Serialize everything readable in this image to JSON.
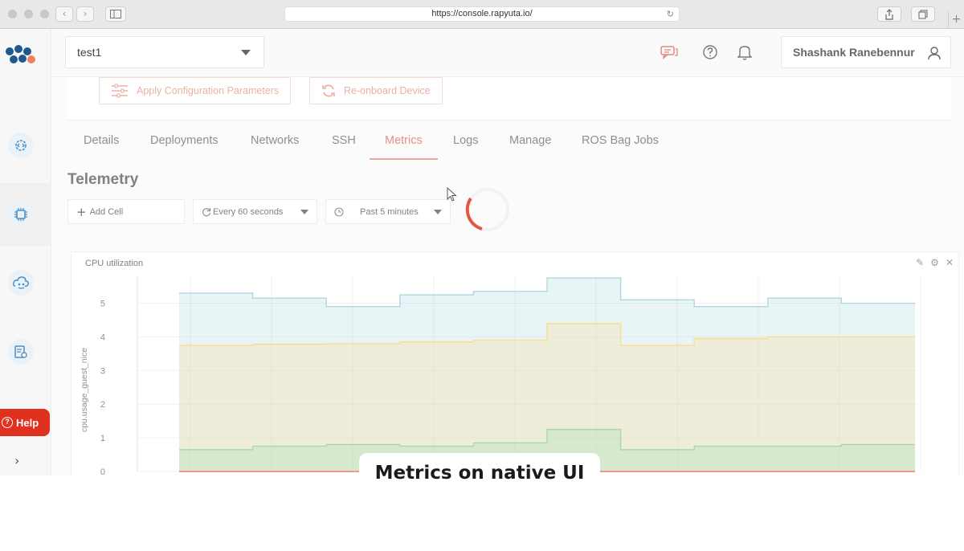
{
  "browser": {
    "url": "https://console.rapyuta.io/",
    "back_icon": "chevron-left-icon",
    "forward_icon": "chevron-right-icon",
    "sidebar_icon": "sidebar-toggle-icon",
    "share_icon": "share-icon",
    "tabs_icon": "tabs-overview-icon",
    "new_tab_icon": "plus-icon"
  },
  "header": {
    "project": "test1",
    "user_name": "Shashank Ranebennur"
  },
  "sidebar": {
    "help_label": "Help",
    "items": [
      {
        "icon": "gear-code-icon"
      },
      {
        "icon": "chip-icon"
      },
      {
        "icon": "cloud-robot-icon"
      },
      {
        "icon": "document-settings-icon"
      }
    ]
  },
  "actions": {
    "apply_config": "Apply Configuration Parameters",
    "reonboard": "Re-onboard Device"
  },
  "tabs": [
    {
      "label": "Details"
    },
    {
      "label": "Deployments"
    },
    {
      "label": "Networks"
    },
    {
      "label": "SSH"
    },
    {
      "label": "Metrics",
      "active": true
    },
    {
      "label": "Logs"
    },
    {
      "label": "Manage"
    },
    {
      "label": "ROS Bag Jobs"
    }
  ],
  "telemetry": {
    "title": "Telemetry",
    "add_cell": "Add Cell",
    "refresh": "Every 60 seconds",
    "range": "Past 5 minutes"
  },
  "colors": {
    "accent": "#e0301e",
    "series_blue": "#9ed0d6",
    "series_yellow": "#f7d675",
    "series_green": "#8fd19e",
    "series_red": "#e06060"
  },
  "chart_data": {
    "type": "area",
    "title": "CPU utilization",
    "ylabel": "cpu.usage_guest_nice",
    "xlabel": "",
    "ylim": [
      0,
      5.8
    ],
    "yticks": [
      0,
      1,
      2,
      3,
      4,
      5
    ],
    "grid": true,
    "x": [
      1,
      2,
      3,
      4,
      5,
      6,
      7,
      8,
      9,
      10
    ],
    "series": [
      {
        "values": [
          5.3,
          5.15,
          4.9,
          5.25,
          5.35,
          5.75,
          5.1,
          4.9,
          5.15,
          5.0
        ],
        "color": "#9ed0d6"
      },
      {
        "values": [
          3.75,
          3.78,
          3.8,
          3.85,
          3.9,
          4.4,
          3.75,
          3.95,
          4.0,
          4.0
        ],
        "color": "#f7d675"
      },
      {
        "values": [
          0.65,
          0.75,
          0.8,
          0.75,
          0.85,
          1.25,
          0.65,
          0.75,
          0.75,
          0.8
        ],
        "color": "#8fd19e"
      },
      {
        "values": [
          0,
          0,
          0,
          0,
          0,
          0,
          0,
          0,
          0,
          0
        ],
        "color": "#e06060"
      }
    ]
  },
  "caption": "Metrics on native UI"
}
